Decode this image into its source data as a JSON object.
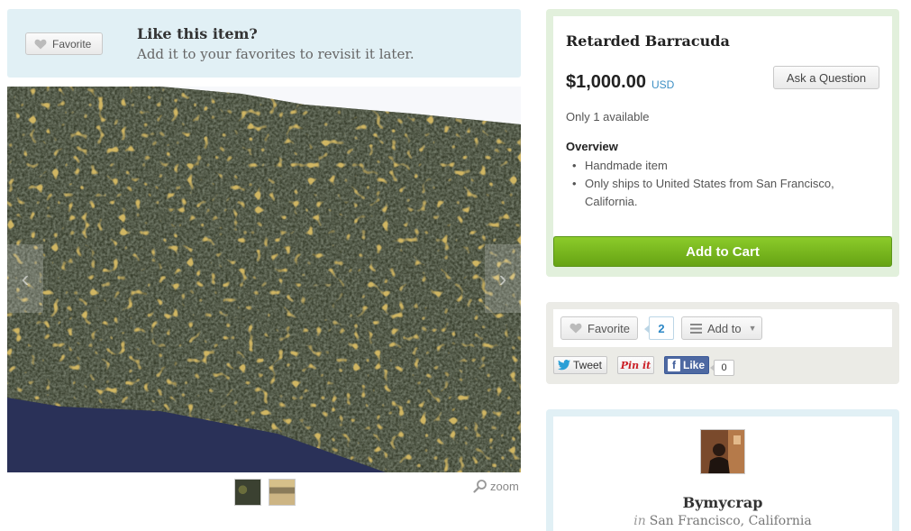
{
  "favorite_banner": {
    "button_label": "Favorite",
    "title": "Like this item?",
    "subtitle": "Add it to your favorites to revisit it later."
  },
  "gallery": {
    "photo_icon": "knitted-fabric-photo",
    "prev_icon": "chevron-left-icon",
    "next_icon": "chevron-right-icon",
    "zoom_label": "zoom"
  },
  "listing": {
    "title": "Retarded Barracuda",
    "price": "$1,000.00",
    "currency": "USD",
    "ask_button": "Ask a Question",
    "availability": "Only 1 available",
    "overview_heading": "Overview",
    "overview_items": [
      "Handmade item",
      "Only ships to United States from San Francisco, California."
    ],
    "cart_button": "Add to Cart"
  },
  "social": {
    "favorite_label": "Favorite",
    "favorite_count": "2",
    "add_to_label": "Add to",
    "tweet_label": "Tweet",
    "pin_label": "Pin it",
    "like_label": "Like",
    "like_count": "0"
  },
  "shop": {
    "name": "Bymycrap",
    "location_prefix": "in",
    "location": "San Francisco, California"
  },
  "colors": {
    "banner_bg": "#e1f0f5",
    "buy_box_bg": "#e2f0dc",
    "cart_green": "#6bb118",
    "link_blue": "#3d8fc4",
    "facebook_blue": "#3b5998"
  }
}
